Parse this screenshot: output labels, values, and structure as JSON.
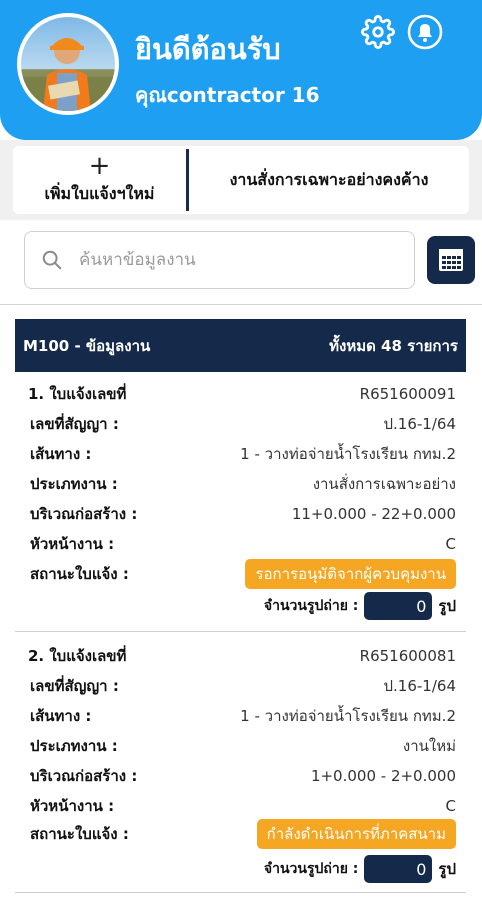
{
  "header": {
    "welcome": "ยินดีต้อนรับ",
    "username": "คุณcontractor 16",
    "background_color": "#1e9ff2",
    "avatar": "contractor-avatar",
    "settings_icon": "gear-icon",
    "notification_icon": "bell-icon"
  },
  "actions": {
    "add_icon": "+",
    "add_label": "เพิ่มใบแจ้งฯใหม่",
    "pending_label": "งานสั่งการเฉพาะอย่างคงค้าง"
  },
  "search": {
    "placeholder": "ค้นหาข้อมูลงาน",
    "calendar_icon": "calendar-icon"
  },
  "table": {
    "title": "M100 - ข้อมูลงาน",
    "total": "ทั้งหมด 48 รายการ",
    "header_color": "#15294b"
  },
  "labels": {
    "contract": "เลขที่สัญญา :",
    "route": "เส้นทาง :",
    "work_type": "ประเภทงาน :",
    "area": "บริเวณก่อสร้าง :",
    "supervisor": "หัวหน้างาน :",
    "status": "สถานะใบแจ้ง :",
    "photo_count": "จำนวนรูปถ่าย :",
    "photo_unit": "รูป"
  },
  "records": [
    {
      "title": "1. ใบแจ้งเลขที่",
      "number": "R651600091",
      "contract": "ป.16-1/64",
      "route": "1 - วางท่อจ่ายน้ำโรงเรียน กทม.2",
      "work_type": "งานสั่งการเฉพาะอย่าง",
      "area": "11+0.000 - 22+0.000",
      "supervisor": "C",
      "status": "รอการอนุมัติจากผู้ควบคุมงาน",
      "photos": "0",
      "status_color": "#f5a623"
    },
    {
      "title": "2. ใบแจ้งเลขที่",
      "number": "R651600081",
      "contract": "ป.16-1/64",
      "route": "1 - วางท่อจ่ายน้ำโรงเรียน กทม.2",
      "work_type": "งานใหม่",
      "area": "1+0.000 - 2+0.000",
      "supervisor": "C",
      "status": "กำลังดำเนินการที่ภาคสนาม",
      "photos": "0",
      "status_color": "#f5a623"
    }
  ]
}
